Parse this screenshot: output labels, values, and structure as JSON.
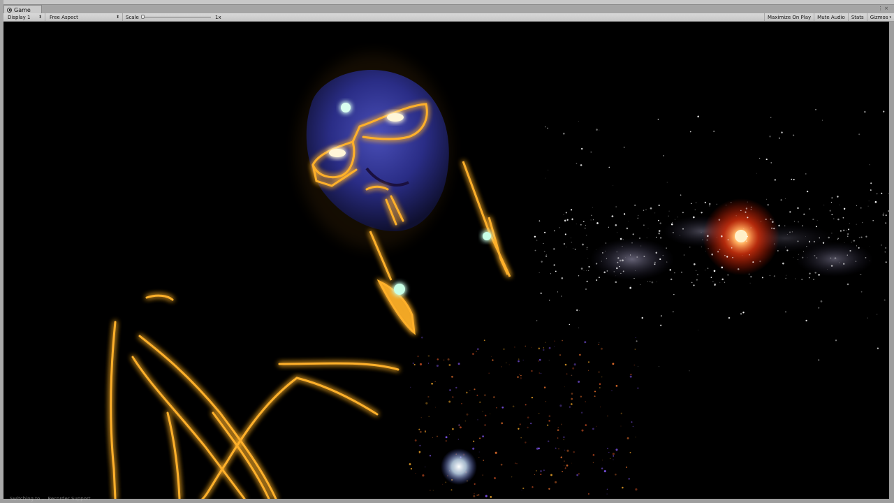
{
  "tab": {
    "label": "Game",
    "icon": "game-controller-icon"
  },
  "toolbar": {
    "display": "Display 1",
    "aspect": "Free Aspect",
    "scale_label": "Scale",
    "scale_value": "1x",
    "maximize": "Maximize On Play",
    "mute": "Mute Audio",
    "stats": "Stats",
    "gizmos": "Gizmos"
  },
  "status_bar": {
    "text": "Switching to ... Recorder Support"
  },
  "colors": {
    "glow_gold": "#ffb02a",
    "face_blue": "#2b2f8a",
    "sun_orange": "#ff5a1a",
    "background": "#000000",
    "editor_gray": "#c8c8c8"
  }
}
